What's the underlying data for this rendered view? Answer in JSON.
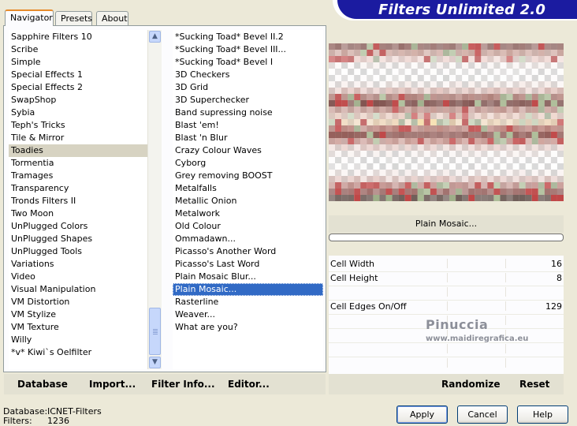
{
  "banner": {
    "title": "Filters Unlimited 2.0"
  },
  "tabs": [
    {
      "label": "Navigator",
      "active": true
    },
    {
      "label": "Presets",
      "active": false
    },
    {
      "label": "About",
      "active": false
    }
  ],
  "categories": {
    "items": [
      "Sapphire Filters 10",
      "Scribe",
      "Simple",
      "Special Effects 1",
      "Special Effects 2",
      "SwapShop",
      "Sybia",
      "Teph's Tricks",
      "Tile & Mirror",
      "Toadies",
      "Tormentia",
      "Tramages",
      "Transparency",
      "Tronds Filters II",
      "Two Moon",
      "UnPlugged Colors",
      "UnPlugged Shapes",
      "UnPlugged Tools",
      "Variations",
      "Video",
      "Visual Manipulation",
      "VM Distortion",
      "VM Stylize",
      "VM Texture",
      "Willy",
      "*v* Kiwi`s Oelfilter"
    ],
    "selected": "Toadies"
  },
  "filters": {
    "items": [
      "*Sucking Toad*  Bevel II.2",
      "*Sucking Toad*  Bevel III...",
      "*Sucking Toad*  Bevel I",
      "3D Checkers",
      "3D Grid",
      "3D Superchecker",
      "Band supressing noise",
      "Blast 'em!",
      "Blast 'n Blur",
      "Crazy Colour Waves",
      "Cyborg",
      "Grey removing BOOST",
      "Metalfalls",
      "Metallic Onion",
      "Metalwork",
      "Old Colour",
      "Ommadawn...",
      "Picasso's Another Word",
      "Picasso's Last Word",
      "Plain Mosaic Blur...",
      "Plain Mosaic...",
      "Rasterline",
      "Weaver...",
      "What are you?"
    ],
    "selected": "Plain Mosaic..."
  },
  "bottom_bar": {
    "database": "Database",
    "import": "Import...",
    "filter_info": "Filter Info...",
    "editor": "Editor..."
  },
  "filter_name": "Plain Mosaic...",
  "params": [
    {
      "label": "Cell Width",
      "value": "16"
    },
    {
      "label": "Cell Height",
      "value": "8"
    },
    {
      "label": "Cell Edges On/Off",
      "value": "129"
    }
  ],
  "right_bar": {
    "randomize": "Randomize",
    "reset": "Reset"
  },
  "watermark": {
    "name": "Pinuccia",
    "site": "www.maidiregrafica.eu"
  },
  "footer": {
    "database_label": "Database:",
    "database_value": "ICNET-Filters",
    "filters_label": "Filters:",
    "filters_value": "1236"
  },
  "buttons": {
    "apply": "Apply",
    "cancel": "Cancel",
    "help": "Help"
  },
  "colors": {
    "banner": "#1b1ba0",
    "selection": "#316ac5",
    "tab_accent": "#e68b2c"
  }
}
